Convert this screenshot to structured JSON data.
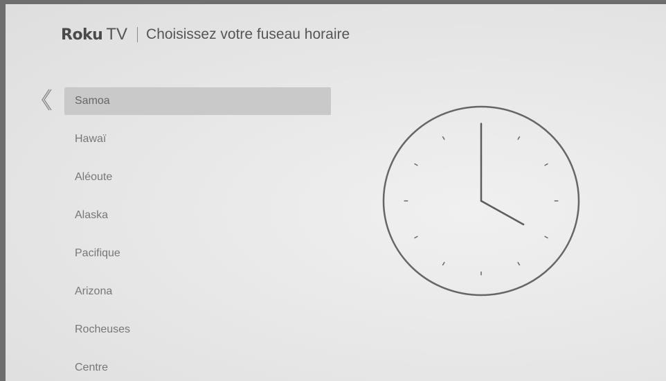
{
  "header": {
    "logo_brand": "Roku",
    "logo_product": "TV",
    "title": "Choisissez votre fuseau horaire"
  },
  "timezones": [
    {
      "label": "Samoa",
      "selected": true
    },
    {
      "label": "Hawaï",
      "selected": false
    },
    {
      "label": "Aléoute",
      "selected": false
    },
    {
      "label": "Alaska",
      "selected": false
    },
    {
      "label": "Pacifique",
      "selected": false
    },
    {
      "label": "Arizona",
      "selected": false
    },
    {
      "label": "Rocheuses",
      "selected": false
    },
    {
      "label": "Centre",
      "selected": false
    }
  ],
  "clock": {
    "hour": 4,
    "minute": 0
  },
  "icons": {
    "back": "chevron-left-icon",
    "clock": "analog-clock-icon"
  },
  "colors": {
    "selected_background": "#c9c9c9",
    "text": "#777777",
    "clock_stroke": "#666666"
  }
}
